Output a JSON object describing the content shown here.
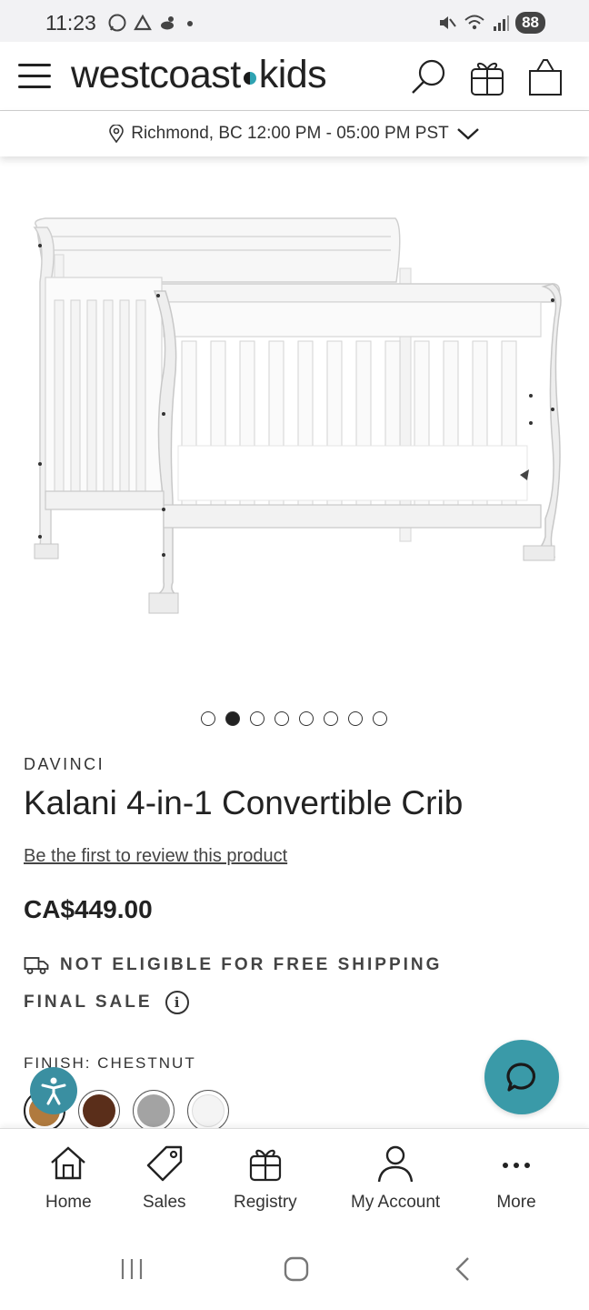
{
  "status_bar": {
    "time": "11:23",
    "battery": "88",
    "left_icons": [
      "whatsapp-icon",
      "drive-icon",
      "weather-icon",
      "dot-icon"
    ],
    "right_icons": [
      "mute-icon",
      "wifi-icon",
      "signal-icon"
    ]
  },
  "header": {
    "logo_part1": "westcoast",
    "logo_part2": "kids",
    "icons": [
      "menu-icon",
      "search-icon",
      "gift-icon",
      "bag-icon"
    ]
  },
  "location": {
    "text": "Richmond, BC 12:00 PM - 05:00 PM PST"
  },
  "product": {
    "brand": "DAVINCI",
    "title": "Kalani 4-in-1 Convertible Crib",
    "review_link": "Be the first to review this product",
    "price": "CA$449.00",
    "shipping": "NOT ELIGIBLE FOR FREE SHIPPING",
    "final_sale": "FINAL SALE",
    "finish_label": "FINISH: CHESTNUT",
    "carousel": {
      "total": 8,
      "active": 2
    },
    "swatches": [
      {
        "name": "Chestnut",
        "color": "#b07a3e",
        "selected": true
      },
      {
        "name": "Espresso",
        "color": "#5a2e1a",
        "selected": false
      },
      {
        "name": "Grey",
        "color": "#a3a3a3",
        "selected": false
      },
      {
        "name": "White",
        "color": "#f4f4f4",
        "selected": false
      }
    ]
  },
  "bottom_nav": {
    "items": [
      {
        "label": "Home",
        "icon": "home-icon"
      },
      {
        "label": "Sales",
        "icon": "tag-icon"
      },
      {
        "label": "Registry",
        "icon": "gift-icon"
      },
      {
        "label": "My Account",
        "icon": "user-icon"
      },
      {
        "label": "More",
        "icon": "more-icon"
      }
    ]
  },
  "colors": {
    "accent": "#3a9aa8",
    "text": "#222222"
  }
}
